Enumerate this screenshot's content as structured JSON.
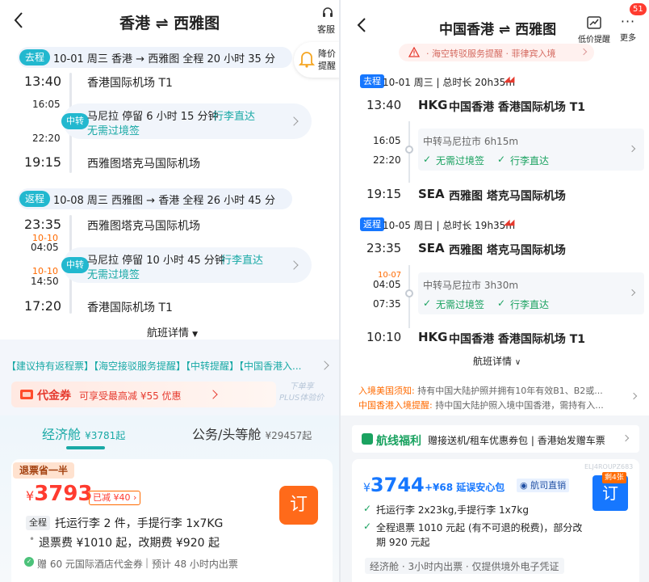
{
  "left": {
    "title": "香港 ⇌ 西雅图",
    "service_label": "客服",
    "price_alert": [
      "降价",
      "提醒"
    ],
    "outbound": {
      "tag": "去程",
      "summary": "10-01 周三   香港 → 西雅图   全程 20 小时 35 分",
      "dep_time": "13:40",
      "dep_airport": "香港国际机场 T1",
      "transfer_arr": "16:05",
      "transfer_dep": "22:20",
      "transfer_badge": "中转",
      "transfer_line1": "马尼拉  停留 6 小时 15 分钟",
      "transfer_baggage": "行李直达",
      "transfer_line2": "无需过境签",
      "arr_time": "19:15",
      "arr_airport": "西雅图塔克马国际机场"
    },
    "inbound": {
      "tag": "返程",
      "summary": "10-08 周三   西雅图 → 香港   全程 26 小时 45 分",
      "dep_time": "23:35",
      "dep_airport": "西雅图塔克马国际机场",
      "transfer_arr_date": "10-10",
      "transfer_arr": "04:05",
      "transfer_dep_date": "10-10",
      "transfer_dep": "14:50",
      "transfer_badge": "中转",
      "transfer_line1": "马尼拉  停留 10 小时 45 分钟",
      "transfer_baggage": "行李直达",
      "transfer_line2": "无需过境签",
      "arr_time": "17:20",
      "arr_airport": "香港国际机场 T1"
    },
    "details_label": "航班详情",
    "notices": "【建议持有返程票】【海空接驳服务提醒】【中转提醒】【中国香港入...",
    "coupon": {
      "label": "代金券",
      "text": "可享受最高减 ¥55 优惠",
      "plus": [
        "下单享",
        "PLUS体验价"
      ]
    },
    "cabins": [
      {
        "name": "经济舱",
        "price": "¥3781起"
      },
      {
        "name": "公务/头等舱",
        "price": "¥29457起"
      }
    ],
    "offer": {
      "tag": "退票省一半",
      "currency": "¥",
      "price": "3793",
      "reduced": "已减 ¥40",
      "book": "订",
      "quan": "全程",
      "baggage": "托运行李 2 件，手提行李 1x7KG",
      "refund": "退票费 ¥1010 起，改期费 ¥920 起",
      "gift": "赠 60 元国际酒店代金券",
      "ticket_time": "预计 48 小时内出票"
    }
  },
  "right": {
    "title": "中国香港 ⇌ 西雅图",
    "low_price": "低价提醒",
    "more": "更多",
    "badge_count": "51",
    "warn": "· 海空转驳服务提醒 · 菲律宾入境",
    "outbound": {
      "tag": "去程",
      "summary": "10-01 周三 | 总时长 20h35m",
      "dep_time": "13:40",
      "dep_code": "HKG",
      "dep_airport": "中国香港 香港国际机场 T1",
      "transfer_arr": "16:05",
      "transfer_dep": "22:20",
      "transfer_text": "中转马尼拉市 6h15m",
      "visa": "无需过境签",
      "baggage": "行李直达",
      "arr_time": "19:15",
      "arr_code": "SEA",
      "arr_airport": "西雅图 塔克马国际机场"
    },
    "inbound": {
      "tag": "返程",
      "summary": "10-05 周日 | 总时长 19h35m",
      "dep_time": "23:35",
      "dep_code": "SEA",
      "dep_airport": "西雅图 塔克马国际机场",
      "transfer_arr_date": "10-07",
      "transfer_arr": "04:05",
      "transfer_dep": "07:35",
      "transfer_text": "中转马尼拉市 3h30m",
      "visa": "无需过境签",
      "baggage": "行李直达",
      "arr_time": "10:10",
      "arr_code": "HKG",
      "arr_airport": "中国香港 香港国际机场 T1"
    },
    "details_label": "航班详情",
    "note1_label": "入境美国须知:",
    "note1_text": "持有中国大陆护照并拥有10年有效B1、B2或...",
    "note2_label": "中国香港入境提醒:",
    "note2_text": "持中国大陆护照入境中国香港，需持有入...",
    "benefit_title": "航线福利",
    "benefit_text": "赠接送机/租车优惠券包 | 香港始发赠车票",
    "offer": {
      "code": "ELJ4ROUPZ683",
      "currency": "¥",
      "price": "3744",
      "addon": "+¥68 延误安心包",
      "airline_direct": "航司直销",
      "book": "订",
      "remaining": "剩4张",
      "baggage": "托运行李 2x23kg,手提行李 1x7kg",
      "refund1": "全程退票 1010 元起 (有不可退的税费)，部分改",
      "refund2": "期 920 元起",
      "footer": "经济舱 · 3小时内出票 · 仅提供境外电子凭证"
    }
  }
}
